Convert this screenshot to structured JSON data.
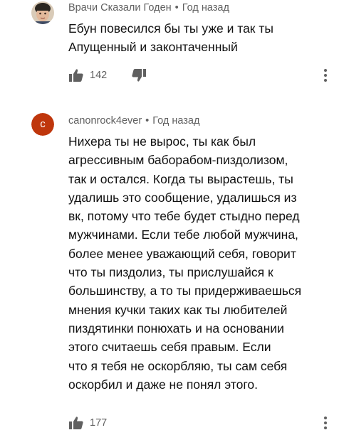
{
  "comments": [
    {
      "author": "Врачи Сказали Годен",
      "time": "Год назад",
      "lines": [
        "Ебун повесился бы ты уже и так ты",
        "Апущенный и законтаченный"
      ],
      "likes": "142",
      "avatar_icon": "user-photo-avatar"
    },
    {
      "author": "canonrock4ever",
      "time": "Год назад",
      "lines": [
        "Нихера ты не вырос, ты как был",
        "агрессивным баборабом-пиздолизом,",
        "так и остался. Когда ты вырастешь, ты",
        "удалишь это сообщение, удалишься из",
        "вк, потому что тебе будет стыдно перед",
        "мужчинами. Если тебе любой мужчина,",
        "более менее уважающий себя, говорит",
        "что ты пиздолиз, ты прислушайся к",
        "большинству, а то ты придерживаешься",
        "мнения кучки таких как ты любителей",
        "пиздятинки понюхать и на основании",
        "этого считаешь себя правым. Если",
        "что я тебя не оскорбляю, ты сам себя",
        "оскорбил и даже не понял этого."
      ],
      "likes": "177",
      "avatar_letter": "c",
      "avatar_color": "#bf360c"
    }
  ],
  "separator": "•",
  "icons": {
    "like": "thumbs-up-icon",
    "dislike": "thumbs-down-icon",
    "more": "more-vert-icon"
  }
}
